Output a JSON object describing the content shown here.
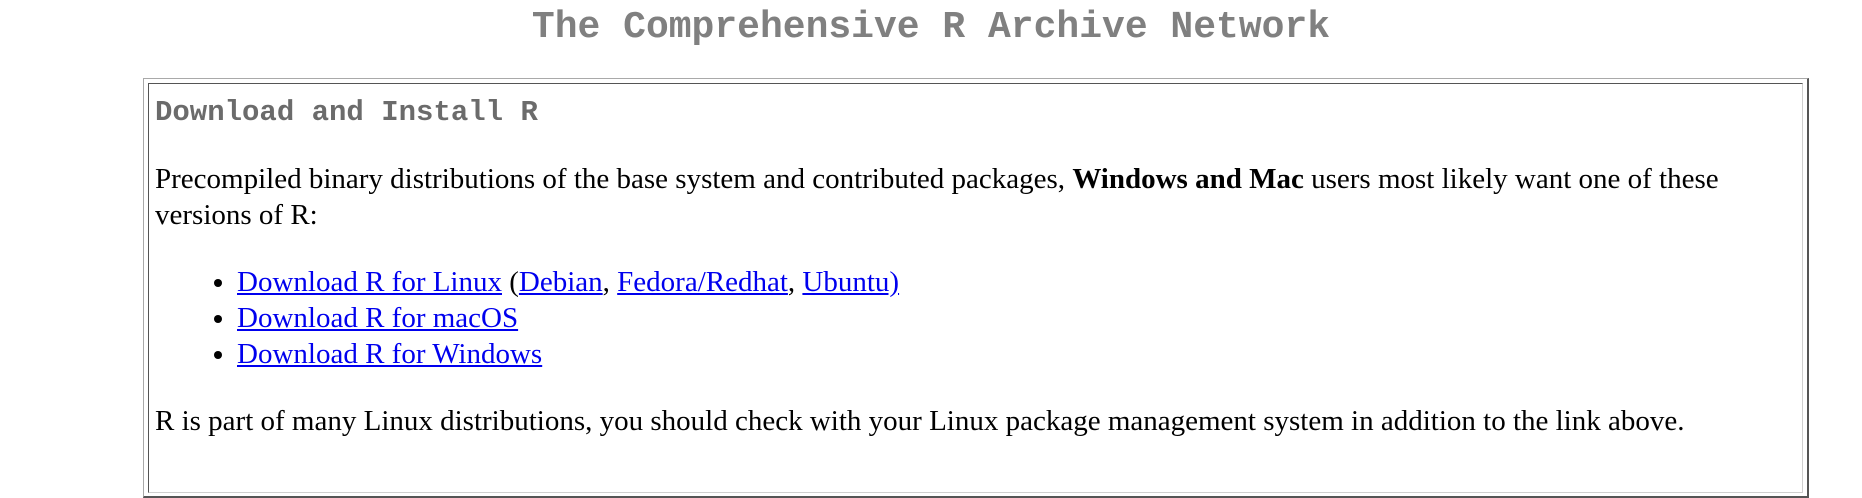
{
  "page": {
    "title": "The Comprehensive R Archive Network"
  },
  "section": {
    "heading": "Download and Install R",
    "intro_before": "Precompiled binary distributions of the base system and contributed packages, ",
    "intro_bold": "Windows and Mac",
    "intro_after": " users most likely want one of these versions of R:",
    "links": {
      "linux": "Download R for Linux",
      "open_paren": " (",
      "debian": "Debian",
      "sep1": ", ",
      "fedora": "Fedora/Redhat",
      "sep2": ", ",
      "ubuntu": "Ubuntu)",
      "macos": "Download R for macOS",
      "windows": "Download R for Windows"
    },
    "note": "R is part of many Linux distributions, you should check with your Linux package management system in addition to the link above."
  },
  "colors": {
    "title_gray": "#808080",
    "heading_gray": "#6b6b6b",
    "link_blue": "#0000ee"
  }
}
